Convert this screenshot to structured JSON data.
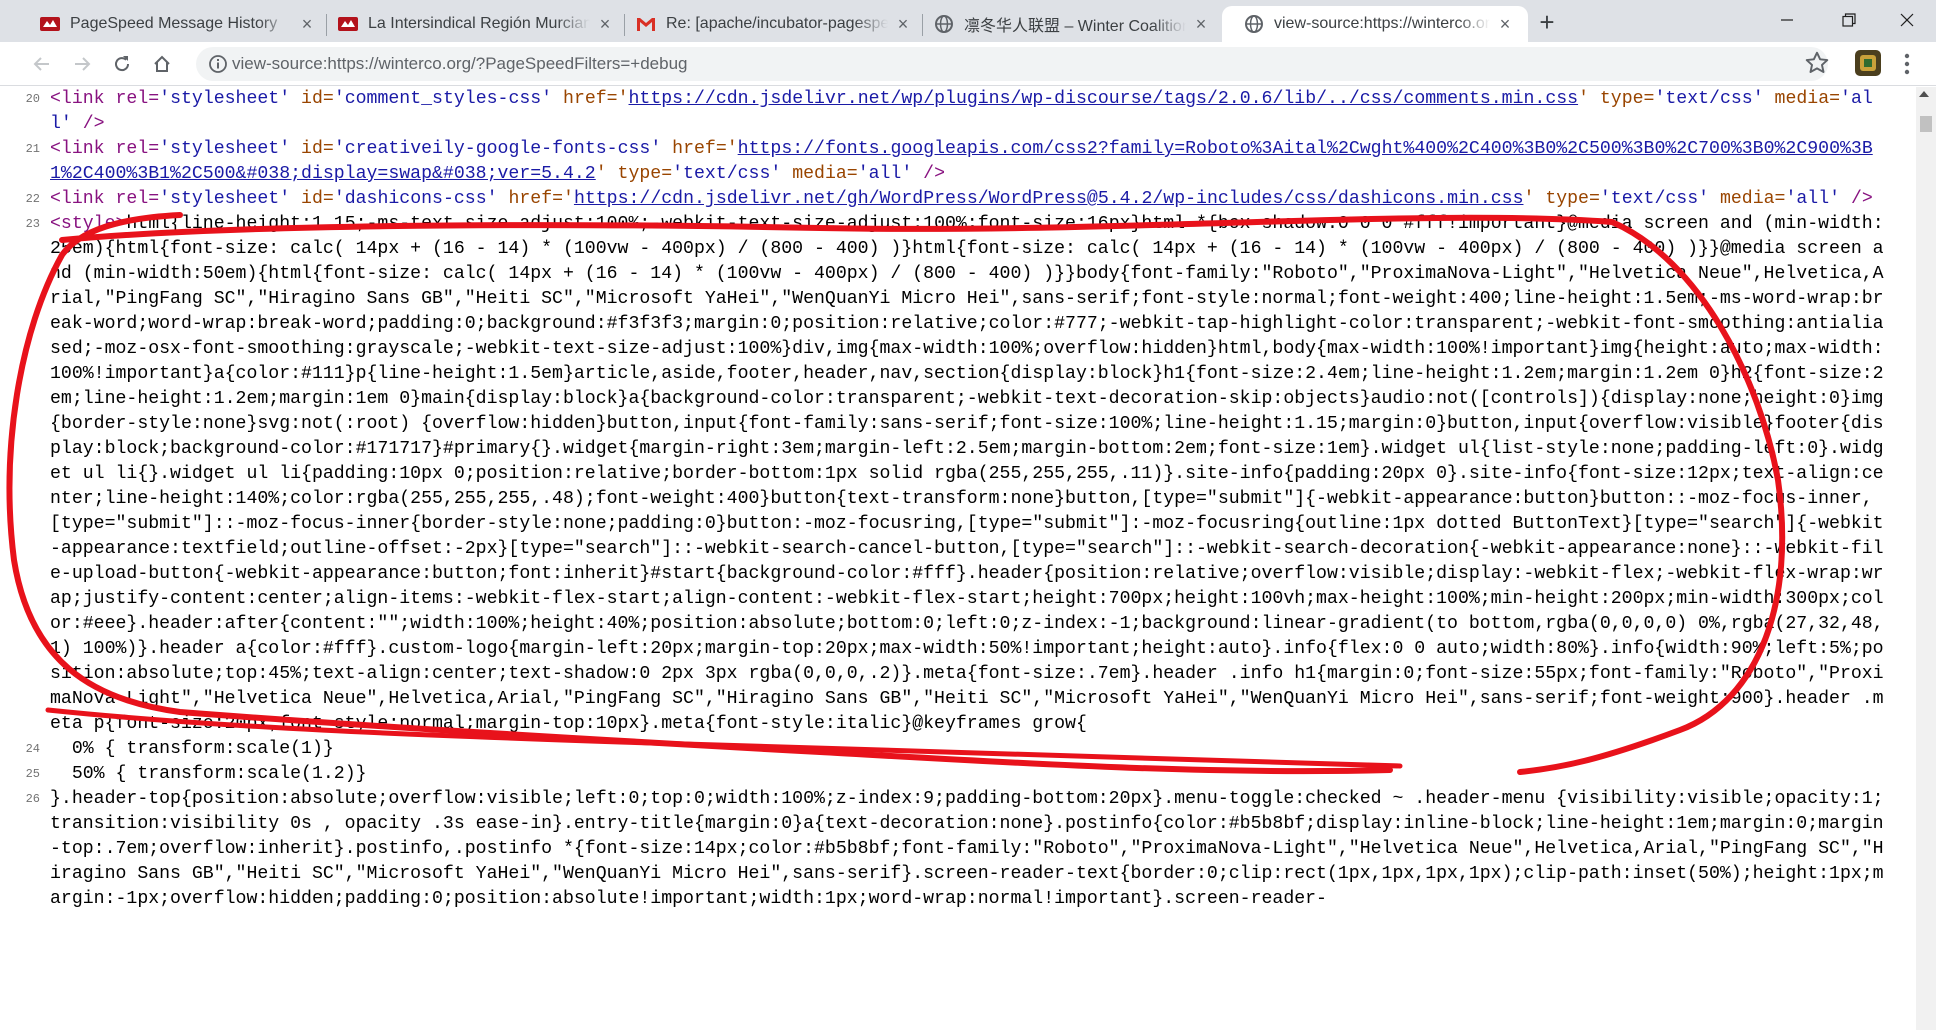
{
  "tabs": [
    {
      "title": "PageSpeed Message History",
      "favicon": "red-bird-icon",
      "active": false
    },
    {
      "title": "La Intersindical Región Murciana",
      "favicon": "red-bird-icon",
      "active": false
    },
    {
      "title": "Re: [apache/incubator-pagespeed",
      "favicon": "gmail-icon",
      "active": false
    },
    {
      "title": "凛冬华人联盟 – Winter Coalition",
      "favicon": "globe-icon",
      "active": false
    },
    {
      "title": "view-source:https://winterco.org",
      "favicon": "globe-icon",
      "active": true
    }
  ],
  "new_tab_label": "+",
  "tab_close_glyph": "×",
  "address_bar": {
    "url": "view-source:https://winterco.org/?PageSpeedFilters=+debug"
  },
  "colors": {
    "tag": "#881280",
    "attribute": "#994500",
    "value": "#1a1aa6",
    "annotation": "#e8121b"
  },
  "source": {
    "l20_num": "20",
    "l20_a": "<link rel=",
    "l20_b": "'stylesheet'",
    "l20_c": " id=",
    "l20_d": "'comment_styles-css'",
    "l20_e": " href='",
    "l20_f": "https://cdn.jsdelivr.net/wp/plugins/wp-discourse/tags/2.0.6/lib/../css/comments.min.css",
    "l20_g": "' type=",
    "l20_h": "'text/css'",
    "l20_i": " media=",
    "l20_j": "'all'",
    "l20_k": " />",
    "l21_num": "21",
    "l21_a": "<link rel=",
    "l21_b": "'stylesheet'",
    "l21_c": " id=",
    "l21_d": "'creativeily-google-fonts-css'",
    "l21_e": " href='",
    "l21_f": "https://fonts.googleapis.com/css2?family=Roboto%3Aital%2Cwght%400%2C400%3B0%2C500%3B0%2C700%3B0%2C900%3B1%2C400%3B1%2C500&#038;display=swap&#038;ver=5.4.2",
    "l21_g": "' type=",
    "l21_h": "'text/css'",
    "l21_i": " media=",
    "l21_j": "'all'",
    "l21_k": " />",
    "l22_num": "22",
    "l22_a": "<link rel=",
    "l22_b": "'stylesheet'",
    "l22_c": " id=",
    "l22_d": "'dashicons-css'",
    "l22_e": " href='",
    "l22_f": "https://cdn.jsdelivr.net/gh/WordPress/WordPress@5.4.2/wp-includes/css/dashicons.min.css",
    "l22_g": "' type=",
    "l22_h": "'text/css'",
    "l22_i": " media=",
    "l22_j": "'all'",
    "l22_k": " />",
    "l23_num": "23",
    "l23_tag": "<style>",
    "l23_css": "html{line-height:1.15;-ms-text-size-adjust:100%;-webkit-text-size-adjust:100%;font-size:16px}html *{box-shadow:0 0 0 #fff!important}@media screen and (min-width:25em){html{font-size: calc( 14px + (16 - 14) * (100vw - 400px) / (800 - 400) )}html{font-size: calc( 14px + (16 - 14) * (100vw - 400px) / (800 - 400) )}}@media screen and (min-width:50em){html{font-size: calc( 14px + (16 - 14) * (100vw - 400px) / (800 - 400) )}}body{font-family:\"Roboto\",\"ProximaNova-Light\",\"Helvetica Neue\",Helvetica,Arial,\"PingFang SC\",\"Hiragino Sans GB\",\"Heiti SC\",\"Microsoft YaHei\",\"WenQuanYi Micro Hei\",sans-serif;font-style:normal;font-weight:400;line-height:1.5em;-ms-word-wrap:break-word;word-wrap:break-word;padding:0;background:#f3f3f3;margin:0;position:relative;color:#777;-webkit-tap-highlight-color:transparent;-webkit-font-smoothing:antialiased;-moz-osx-font-smoothing:grayscale;-webkit-text-size-adjust:100%}div,img{max-width:100%;overflow:hidden}html,body{max-width:100%!important}img{height:auto;max-width:100%!important}a{color:#111}p{line-height:1.5em}article,aside,footer,header,nav,section{display:block}h1{font-size:2.4em;line-height:1.2em;margin:1.2em 0}h2{font-size:2em;line-height:1.2em;margin:1em 0}main{display:block}a{background-color:transparent;-webkit-text-decoration-skip:objects}audio:not([controls]){display:none;height:0}img{border-style:none}svg:not(:root) {overflow:hidden}button,input{font-family:sans-serif;font-size:100%;line-height:1.15;margin:0}button,input{overflow:visible}footer{display:block;background-color:#171717}#primary{}.widget{margin-right:3em;margin-left:2.5em;margin-bottom:2em;font-size:1em}.widget ul{list-style:none;padding-left:0}.widget ul li{}.widget ul li{padding:10px 0;position:relative;border-bottom:1px solid rgba(255,255,255,.11)}.site-info{padding:20px 0}.site-info{font-size:12px;text-align:center;line-height:140%;color:rgba(255,255,255,.48);font-weight:400}button{text-transform:none}button,[type=\"submit\"]{-webkit-appearance:button}button::-moz-focus-inner,[type=\"submit\"]::-moz-focus-inner{border-style:none;padding:0}button:-moz-focusring,[type=\"submit\"]:-moz-focusring{outline:1px dotted ButtonText}[type=\"search\"]{-webkit-appearance:textfield;outline-offset:-2px}[type=\"search\"]::-webkit-search-cancel-button,[type=\"search\"]::-webkit-search-decoration{-webkit-appearance:none}::-webkit-file-upload-button{-webkit-appearance:button;font:inherit}#start{background-color:#fff}.header{position:relative;overflow:visible;display:-webkit-flex;-webkit-flex-wrap:wrap;justify-content:center;align-items:-webkit-flex-start;align-content:-webkit-flex-start;height:700px;height:100vh;max-height:100%;min-height:200px;min-width:300px;color:#eee}.header:after{content:\"\";width:100%;height:40%;position:absolute;bottom:0;left:0;z-index:-1;background:linear-gradient(to bottom,rgba(0,0,0,0) 0%,rgba(27,32,48,1) 100%)}.header a{color:#fff}.custom-logo{margin-left:20px;margin-top:20px;max-width:50%!important;height:auto}.info{flex:0 0 auto;width:80%}.info{width:90%;left:5%;position:absolute;top:45%;text-align:center;text-shadow:0 2px 3px rgba(0,0,0,.2)}.meta{font-size:.7em}.header .info h1{margin:0;font-size:55px;font-family:\"Roboto\",\"ProximaNova-Light\",\"Helvetica Neue\",Helvetica,Arial,\"PingFang SC\",\"Hiragino Sans GB\",\"Heiti SC\",\"Microsoft YaHei\",\"WenQuanYi Micro Hei\",sans-serif;font-weight:900}.header .meta p{font-size:20px;font-style:normal;margin-top:10px}.meta{font-style:italic}@keyframes grow{",
    "l24_num": "24",
    "l24": "  0% { transform:scale(1)}",
    "l25_num": "25",
    "l25": "  50% { transform:scale(1.2)}",
    "l26_num": "26",
    "l26": "}.header-top{position:absolute;overflow:visible;left:0;top:0;width:100%;z-index:9;padding-bottom:20px}.menu-toggle:checked ~ .header-menu {visibility:visible;opacity:1;transition:visibility 0s , opacity .3s ease-in}.entry-title{margin:0}a{text-decoration:none}.postinfo{color:#b5b8bf;display:inline-block;line-height:1em;margin:0;margin-top:.7em;overflow:inherit}.postinfo,.postinfo *{font-size:14px;color:#b5b8bf;font-family:\"Roboto\",\"ProximaNova-Light\",\"Helvetica Neue\",Helvetica,Arial,\"PingFang SC\",\"Hiragino Sans GB\",\"Heiti SC\",\"Microsoft YaHei\",\"WenQuanYi Micro Hei\",sans-serif}.screen-reader-text{border:0;clip:rect(1px,1px,1px,1px);clip-path:inset(50%);height:1px;margin:-1px;overflow:hidden;padding:0;position:absolute!important;width:1px;word-wrap:normal!important}.screen-reader-"
  }
}
